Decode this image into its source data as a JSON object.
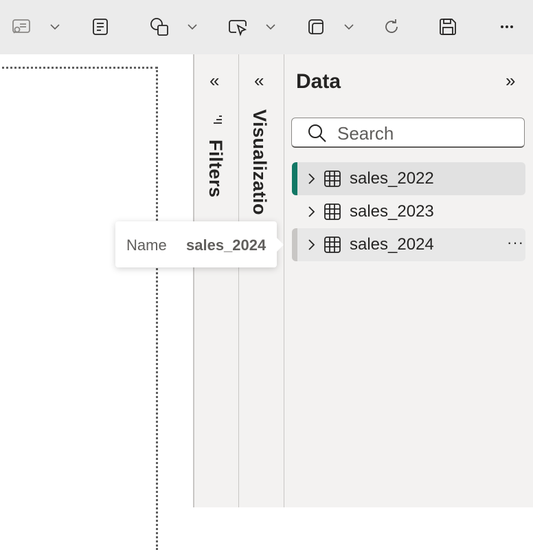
{
  "toolbar": {
    "icons": [
      "qna-icon",
      "chevron-down-icon",
      "text-box-icon",
      "shapes-icon",
      "chevron-down-icon",
      "buttons-icon",
      "chevron-down-icon",
      "visual-gallery-icon",
      "chevron-down-icon",
      "refresh-icon",
      "save-icon",
      "more-options-icon"
    ]
  },
  "filters": {
    "label": "Filters",
    "collapse_glyph": "«"
  },
  "visualizations": {
    "label": "Visualizatio",
    "collapse_glyph": "«"
  },
  "data": {
    "title": "Data",
    "expand_glyph": "»",
    "search_placeholder": "Search",
    "tables": [
      {
        "name": "sales_2022",
        "state": "selected",
        "accent": "#117865"
      },
      {
        "name": "sales_2023",
        "state": "normal"
      },
      {
        "name": "sales_2024",
        "state": "hover",
        "accent": "#c8c6c4",
        "more": "···"
      }
    ]
  },
  "tooltip": {
    "key": "Name",
    "value": "sales_2024"
  }
}
